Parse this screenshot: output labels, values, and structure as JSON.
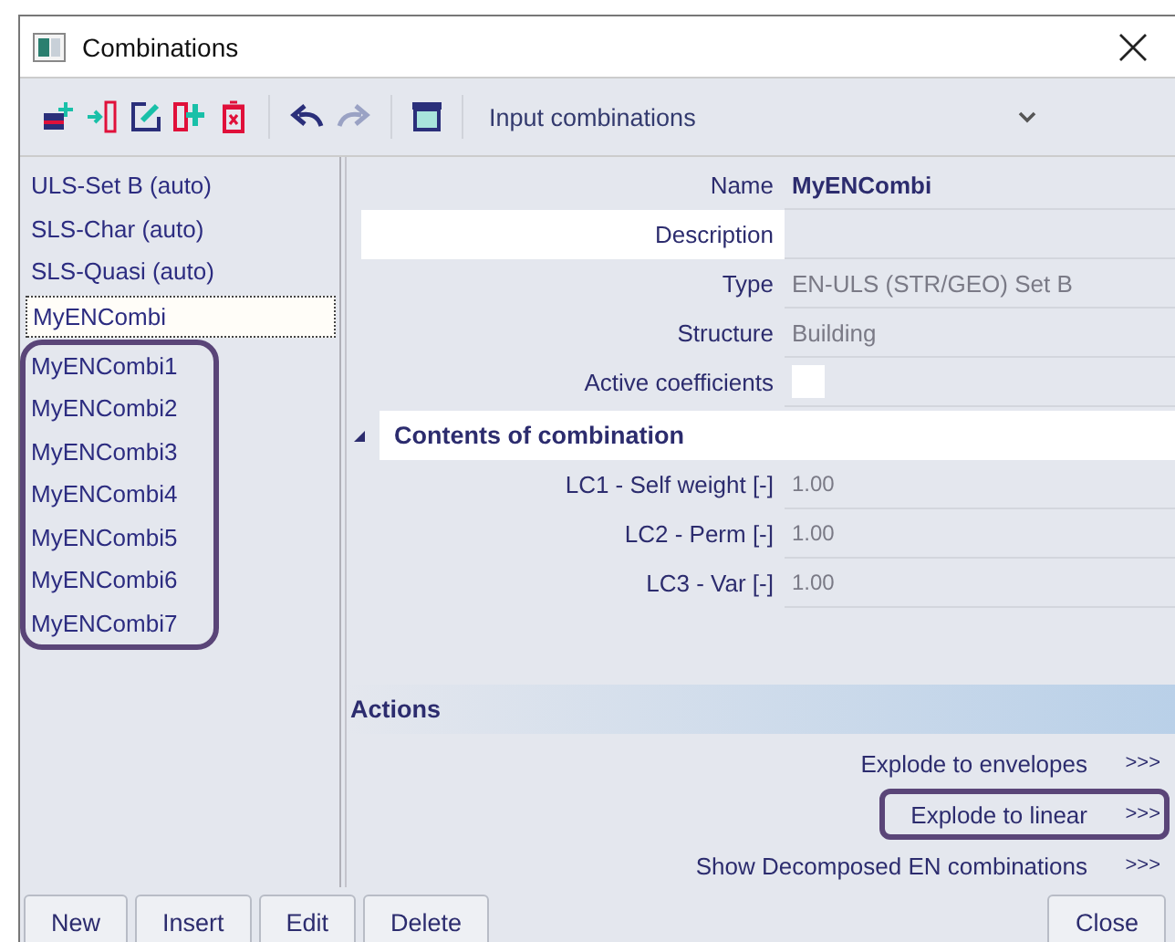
{
  "window": {
    "title": "Combinations"
  },
  "toolbar": {
    "dropdown": "Input combinations"
  },
  "sidebar": {
    "items": [
      {
        "label": "ULS-Set B (auto)",
        "selected": false
      },
      {
        "label": "SLS-Char (auto)",
        "selected": false
      },
      {
        "label": "SLS-Quasi (auto)",
        "selected": false
      },
      {
        "label": "MyENCombi",
        "selected": true
      }
    ],
    "circled_items": [
      {
        "label": "MyENCombi1",
        "selected": false
      },
      {
        "label": "MyENCombi2",
        "selected": false
      },
      {
        "label": "MyENCombi3",
        "selected": false
      },
      {
        "label": "MyENCombi4",
        "selected": false
      },
      {
        "label": "MyENCombi5",
        "selected": false
      },
      {
        "label": "MyENCombi6",
        "selected": false
      },
      {
        "label": "MyENCombi7",
        "selected": false
      }
    ]
  },
  "properties": [
    {
      "kind": "text",
      "label": "Name",
      "value": "MyENCombi",
      "disabled": false,
      "focused": false
    },
    {
      "kind": "text",
      "label": "Description",
      "focused": true
    },
    {
      "kind": "text",
      "label": "Type",
      "value": "EN-ULS (STR/GEO) Set B",
      "disabled": true,
      "focused": false
    },
    {
      "kind": "text",
      "label": "Structure",
      "value": "Building",
      "disabled": true,
      "focused": false
    },
    {
      "kind": "checkbox",
      "label": "Active coefficients",
      "checked": false,
      "focused": false
    }
  ],
  "contents": {
    "title": "Contents of combination",
    "expanded": true,
    "rows": [
      {
        "label": "LC1 - Self weight [-]",
        "value": "1.00"
      },
      {
        "label": "LC2 - Perm [-]",
        "value": "1.00"
      },
      {
        "label": "LC3 - Var [-]",
        "value": "1.00"
      }
    ]
  },
  "actions": {
    "title": "Actions",
    "items": [
      {
        "label": "Explode to envelopes",
        "arrow": ">>>",
        "circled": false
      },
      {
        "label": "Explode to linear",
        "arrow": ">>>",
        "circled": true
      },
      {
        "label": "Show Decomposed EN combinations",
        "arrow": ">>>",
        "circled": false
      }
    ]
  },
  "buttons": [
    "New",
    "Insert",
    "Edit",
    "Delete"
  ],
  "close_button": "Close"
}
